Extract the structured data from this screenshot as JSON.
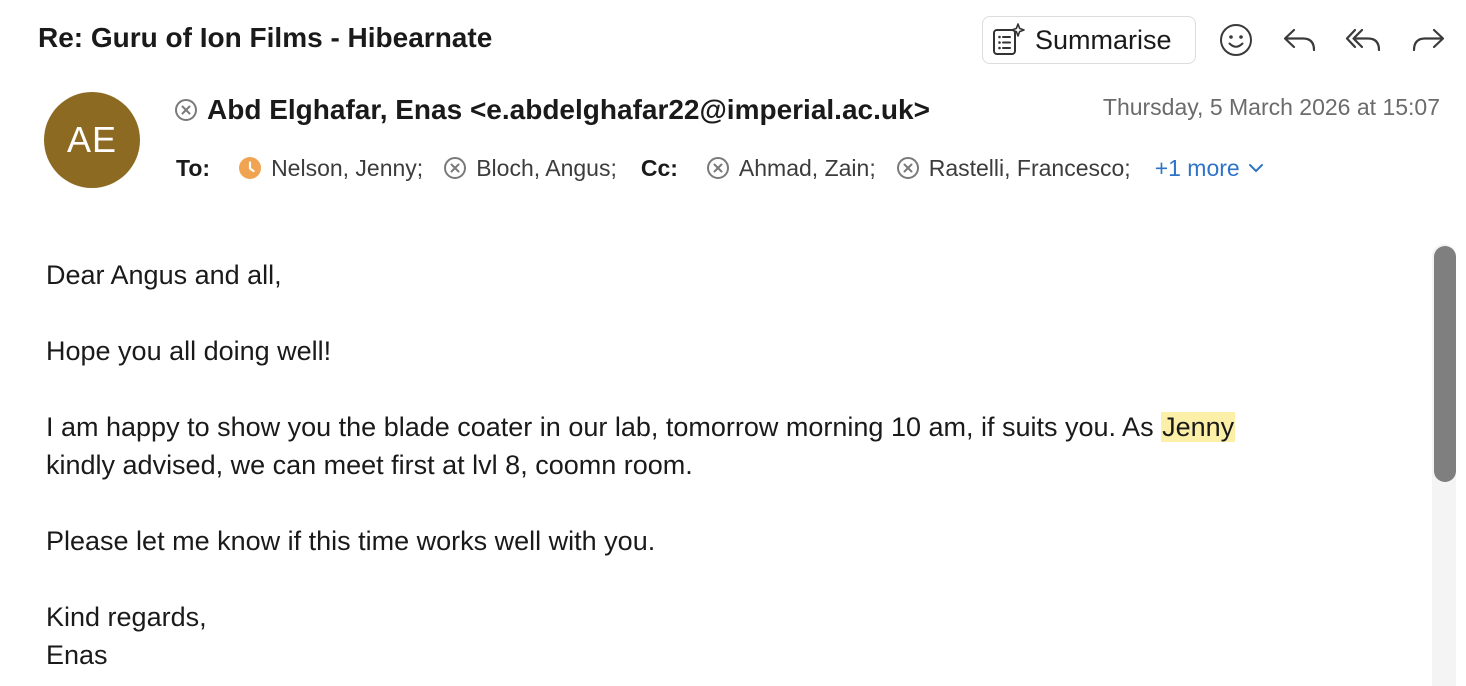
{
  "subject": "Re: Guru of Ion Films - Hibearnate",
  "toolbar": {
    "summarise_label": "Summarise",
    "icons": [
      "summarise-sparkle-icon",
      "emoji-smile-icon",
      "reply-icon",
      "reply-all-icon",
      "forward-icon"
    ]
  },
  "sender": {
    "initials": "AE",
    "avatar_color": "#8c6a22",
    "display": "Abd Elghafar, Enas <e.abdelghafar22@imperial.ac.uk>",
    "date": "Thursday, 5 March 2026 at 15:07"
  },
  "recipients": {
    "to_label": "To:",
    "cc_label": "Cc:",
    "to": [
      {
        "name": "Nelson, Jenny;",
        "status": "away"
      },
      {
        "name": "Bloch, Angus;",
        "status": "unknown"
      }
    ],
    "cc": [
      {
        "name": "Ahmad, Zain;",
        "status": "unknown"
      },
      {
        "name": "Rastelli, Francesco;",
        "status": "unknown"
      }
    ],
    "more_label": "+1 more"
  },
  "body": {
    "greeting": "Dear Angus and all,",
    "line1": "Hope you all doing well!",
    "line2_pre": "I am happy to show you the blade coater in our lab, tomorrow morning 10 am, if suits you. As ",
    "line2_highlight": "Jenny",
    "line3": "kindly advised, we can meet first at lvl 8, coomn room.",
    "line4": "Please let me know if this time works well with you.",
    "signoff": "Kind regards,",
    "signature": "Enas"
  },
  "colors": {
    "link": "#2f74c6",
    "highlight": "#fcf0a8",
    "away_status": "#f0a452",
    "date_text": "#6b6b6b"
  }
}
